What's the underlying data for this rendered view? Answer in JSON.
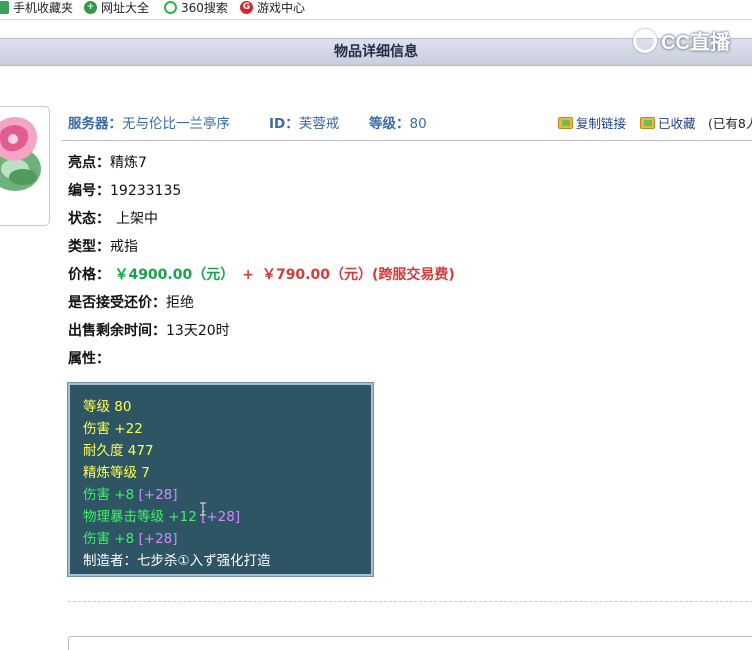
{
  "favorites": [
    {
      "label": "手机收藏夹",
      "icon": "phone-icon"
    },
    {
      "label": "网址大全",
      "icon": "plus-icon"
    },
    {
      "label": "360搜索",
      "icon": "360-search-icon"
    },
    {
      "label": "游戏中心",
      "icon": "game-center-icon"
    }
  ],
  "watermark": "CC直播",
  "page_title": "物品详细信息",
  "info": {
    "server_label": "服务器：",
    "server_value": "无与伦比一兰亭序",
    "id_label": "ID：",
    "id_value": "芙蓉戒",
    "level_label": "等级：",
    "level_value": "80",
    "copy_link": "复制链接",
    "favorited": "已收藏",
    "fav_count": "(已有8人"
  },
  "details": {
    "highlight_label": "亮点：",
    "highlight_value": "精炼7",
    "number_label": "编号：",
    "number_value": "19233135",
    "status_label": "状态：",
    "status_value": "上架中",
    "type_label": "类型：",
    "type_value": "戒指",
    "price_label": "价格：",
    "price_value": "￥4900.00（元）",
    "price_plus": "+",
    "fee_value": "￥790.00（元）(跨服交易费)",
    "counter_label": "是否接受还价：",
    "counter_value": "拒绝",
    "remaining_label": "出售剩余时间：",
    "remaining_value": "13天20时",
    "attr_label": "属性："
  },
  "attributes": {
    "a1": "等级 80",
    "a2": "伤害 +22",
    "a3": "耐久度 477",
    "a4": "精炼等级 7",
    "a5_main": "伤害 +8",
    "a5_bonus": "[+28]",
    "a6_main": "物理暴击等级 +12",
    "a6_bonus": "[+28]",
    "a7_main": "伤害 +8",
    "a7_bonus": "[+28]",
    "a8": "制造者：七步杀①入ず强化打造"
  },
  "colors": {
    "label_blue": "#3a6aa8",
    "price_green": "#16a34a",
    "fee_red": "#d43a3a",
    "attr_bg": "#2e5564"
  }
}
